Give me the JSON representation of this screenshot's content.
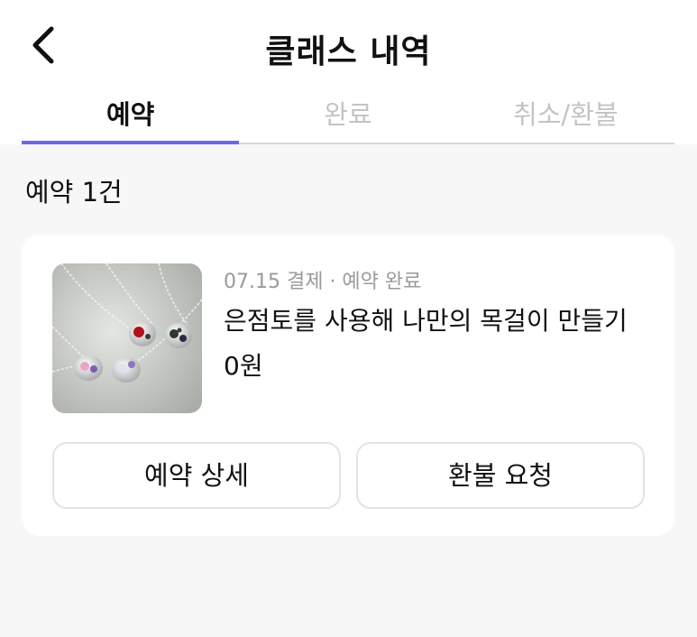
{
  "header": {
    "title": "클래스 내역",
    "back_icon": "chevron-left-icon"
  },
  "tabs": [
    {
      "label": "예약",
      "active": true
    },
    {
      "label": "완료",
      "active": false
    },
    {
      "label": "취소/환불",
      "active": false
    }
  ],
  "accent_color": "#6f67e6",
  "reservation_count": "예약 1건",
  "card": {
    "image": "silver-necklace-image",
    "meta": "07.15  결제 · 예약 완료",
    "class_name": "은점토를 사용해 나만의 목걸이 만들기",
    "price": "0원",
    "detail_button": "예약 상세",
    "refund_button": "환불 요청"
  }
}
